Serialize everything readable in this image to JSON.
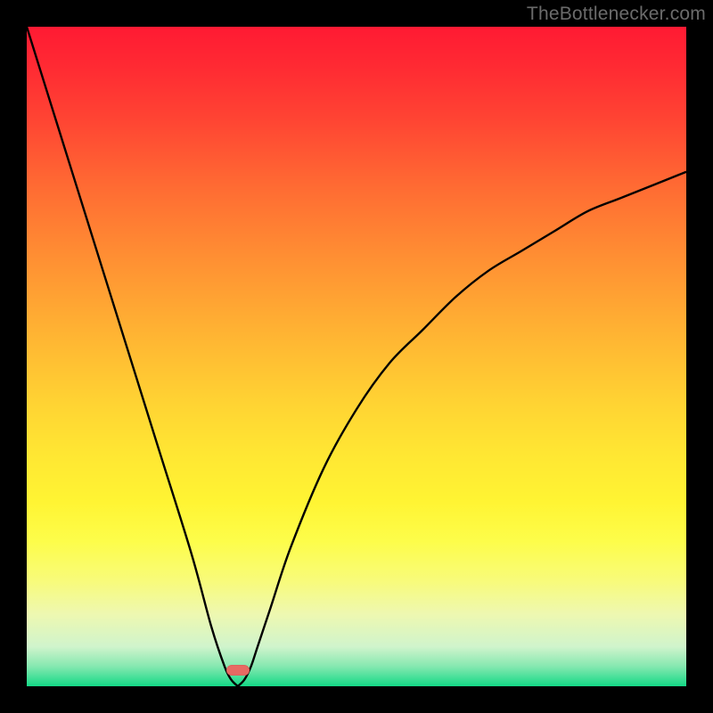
{
  "watermark": {
    "text": "TheBottlenecker.com"
  },
  "chart_data": {
    "type": "line",
    "title": "",
    "xlabel": "",
    "ylabel": "",
    "xlim": [
      0,
      100
    ],
    "ylim": [
      0,
      100
    ],
    "x": [
      0,
      5,
      10,
      15,
      20,
      25,
      28,
      30,
      31,
      32,
      33,
      34,
      35,
      37,
      40,
      45,
      50,
      55,
      60,
      65,
      70,
      75,
      80,
      85,
      90,
      95,
      100
    ],
    "values": [
      100,
      84,
      68,
      52,
      36,
      20,
      9,
      3,
      1,
      0,
      1,
      3,
      6,
      12,
      21,
      33,
      42,
      49,
      54,
      59,
      63,
      66,
      69,
      72,
      74,
      76,
      78
    ],
    "minimum_x": 32,
    "marker": {
      "x_pct": 32,
      "color": "#e76a63"
    },
    "background": "rainbow-vertical-gradient",
    "series": [
      {
        "name": "bottleneck-curve",
        "color": "#000000"
      }
    ]
  }
}
